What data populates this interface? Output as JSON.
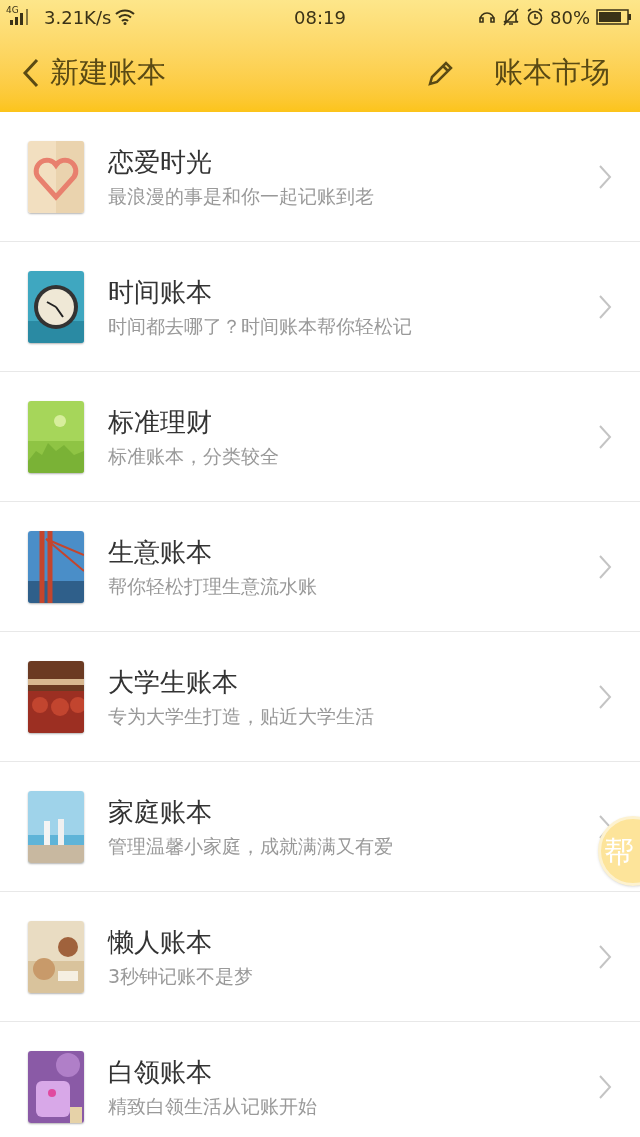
{
  "status_bar": {
    "network": "4G",
    "speed": "3.21K/s",
    "time": "08:19",
    "battery": "80%"
  },
  "nav": {
    "back_title": "新建账本",
    "action": "账本市场"
  },
  "books": [
    {
      "title": "恋爱时光",
      "subtitle": "最浪漫的事是和你一起记账到老"
    },
    {
      "title": "时间账本",
      "subtitle": "时间都去哪了？时间账本帮你轻松记"
    },
    {
      "title": "标准理财",
      "subtitle": "标准账本，分类较全"
    },
    {
      "title": "生意账本",
      "subtitle": "帮你轻松打理生意流水账"
    },
    {
      "title": "大学生账本",
      "subtitle": "专为大学生打造，贴近大学生活"
    },
    {
      "title": "家庭账本",
      "subtitle": "管理温馨小家庭，成就满满又有爱"
    },
    {
      "title": "懒人账本",
      "subtitle": "3秒钟记账不是梦"
    },
    {
      "title": "白领账本",
      "subtitle": "精致白领生活从记账开始"
    }
  ],
  "float_button": {
    "label": "帮"
  }
}
